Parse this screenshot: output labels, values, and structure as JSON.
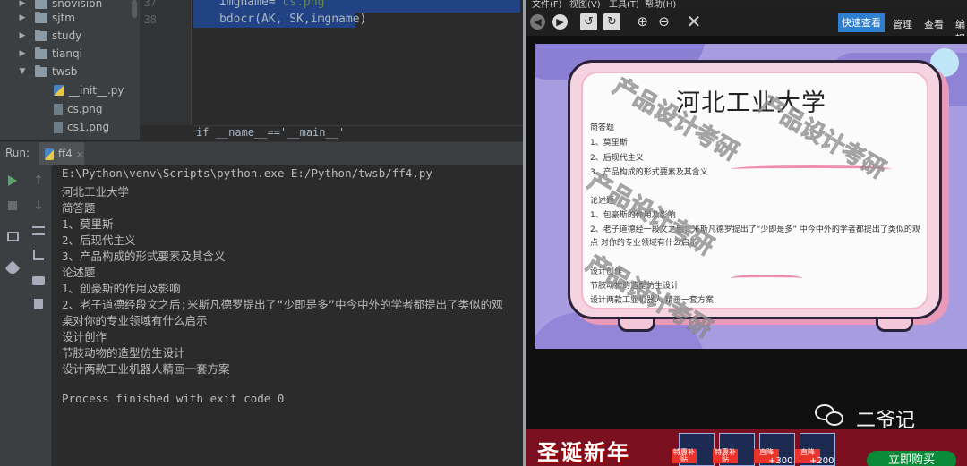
{
  "ide": {
    "tree": [
      {
        "name": "snovision",
        "type": "folder"
      },
      {
        "name": "sjtm",
        "type": "folder"
      },
      {
        "name": "study",
        "type": "folder"
      },
      {
        "name": "tianqi",
        "type": "folder"
      },
      {
        "name": "twsb",
        "type": "folder"
      },
      {
        "name": "__init__.py",
        "type": "py"
      },
      {
        "name": "cs.png",
        "type": "file"
      },
      {
        "name": "cs1.png",
        "type": "file"
      }
    ],
    "line_numbers": [
      "37",
      "38"
    ],
    "code": {
      "line37_var": "imgname=",
      "line37_str": "'cs.png'",
      "line38": "bdocr(AK, SK,imgname)"
    },
    "breadcrumb": "if __name__=='__main__'",
    "run_label": "Run:",
    "run_tab": "ff4",
    "run_tab_close": "×",
    "console_lines": [
      "E:\\Python\\venv\\Scripts\\python.exe E:/Python/twsb/ff4.py",
      "河北工业大学",
      "简答题",
      "1、莫里斯",
      "2、后现代主义",
      "3、产品构成的形式要素及其含义",
      "论述题",
      "1、创豪斯的作用及影响",
      "2、老子道德经段文之后;米斯凡德罗提出了“少即是多”中今中外的学者都提出了类似的观",
      "桌对你的专业领域有什么启示",
      "设计创作",
      "节肢动物的造型仿生设计",
      "设计两款工业机器人精画一套方案",
      "",
      "Process finished with exit code 0"
    ]
  },
  "viewer": {
    "menu": [
      "文件(F)",
      "视图(V)",
      "工具(T)",
      "帮助(H)"
    ],
    "close_glyph": "✕",
    "quick_view": "快速查看",
    "manage": "管理",
    "view": "查看",
    "edit": "编辑",
    "slide": {
      "title": "河北工业大学",
      "lines": [
        "简答题",
        "1、莫里斯",
        "2、后现代主义",
        "3、产品构成的形式要素及其含义",
        "论述题",
        "1、包豪斯的作用及影响",
        "2、老子道德经一段文之后；米斯凡德罗提出了“少即是多” 中今中外的学者都提出了类似的观",
        "点 对你的专业领域有什么启示",
        "设计创作",
        "节肢动物的造型仿生设计",
        "设计两款工业机器人 精画一套方案"
      ],
      "watermark": "产品设计考研"
    },
    "wechat_name": "二爷记",
    "promo": {
      "headline": "圣诞新年",
      "tags": [
        "特惠补贴",
        "特惠补贴",
        "直降",
        "直降"
      ],
      "plus": [
        "+300",
        "+200"
      ],
      "buy": "立即购买"
    }
  },
  "colors": {
    "ide_bg": "#2b2b2b",
    "selection": "#214283",
    "string": "#6a8759",
    "accent": "#2f7fd0"
  }
}
